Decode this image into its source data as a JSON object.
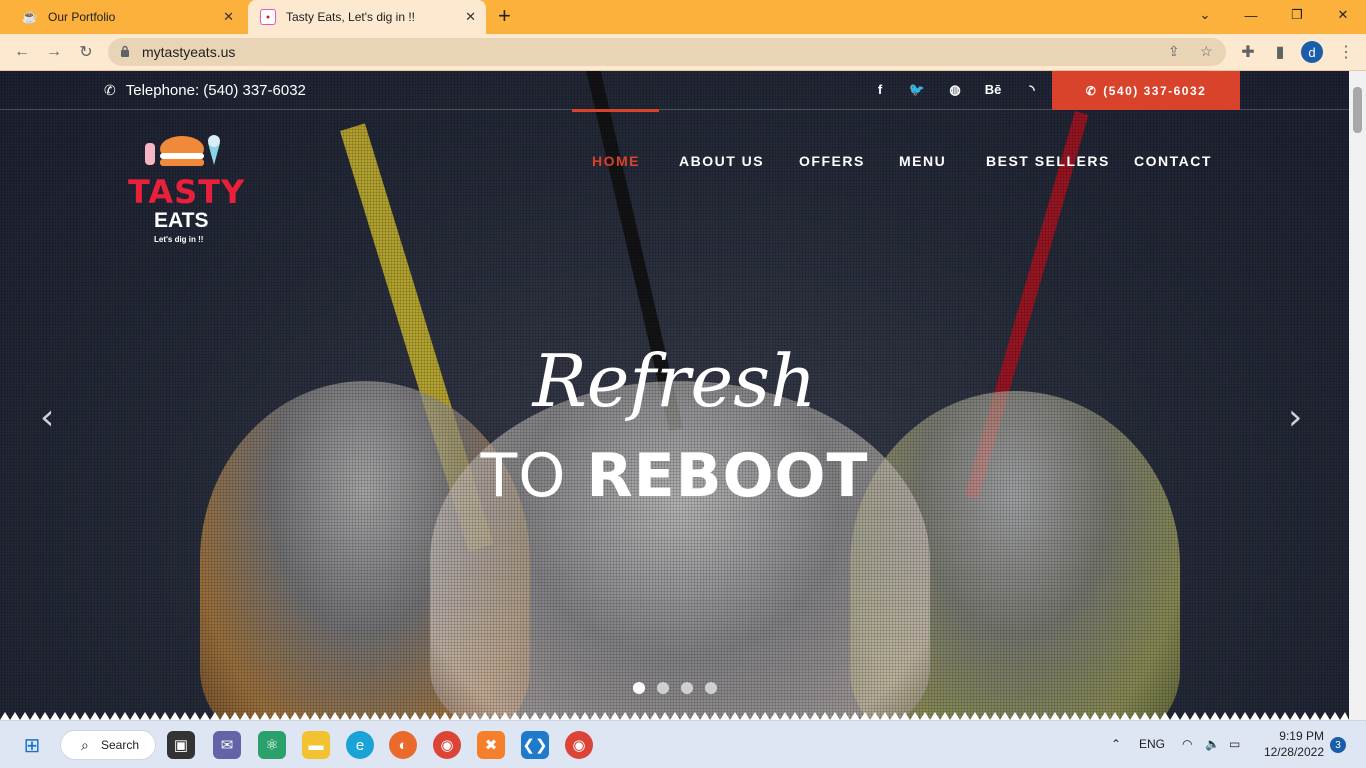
{
  "browser": {
    "tabs": [
      {
        "title": "Our Portfolio",
        "active": false
      },
      {
        "title": "Tasty Eats, Let's dig in !!",
        "active": true
      }
    ],
    "url": "mytastyeats.us",
    "profile_initial": "d"
  },
  "site": {
    "topbar": {
      "telephone_label": "Telephone: (540) 337-6032",
      "phone_button": "(540) 337-6032",
      "social": [
        "f",
        "t",
        "dribbble",
        "Bē",
        "rss"
      ]
    },
    "logo": {
      "brand_line1": "TASTY",
      "brand_line2": "EATS",
      "tagline": "Let's dig in !!"
    },
    "nav": [
      "HOME",
      "ABOUT US",
      "OFFERS",
      "MENU",
      "BEST SELLERS",
      "CONTACT"
    ],
    "active_nav": "HOME",
    "hero": {
      "line1": "Refresh",
      "line2_plain": "TO",
      "line2_bold": "REBOOT",
      "slides": 4,
      "active_slide": 1
    },
    "colors": {
      "accent": "#d9422b",
      "brand_red": "#e8203a"
    }
  },
  "taskbar": {
    "search_label": "Search",
    "language": "ENG",
    "time": "9:19 PM",
    "date": "12/28/2022",
    "notification_count": "3"
  }
}
